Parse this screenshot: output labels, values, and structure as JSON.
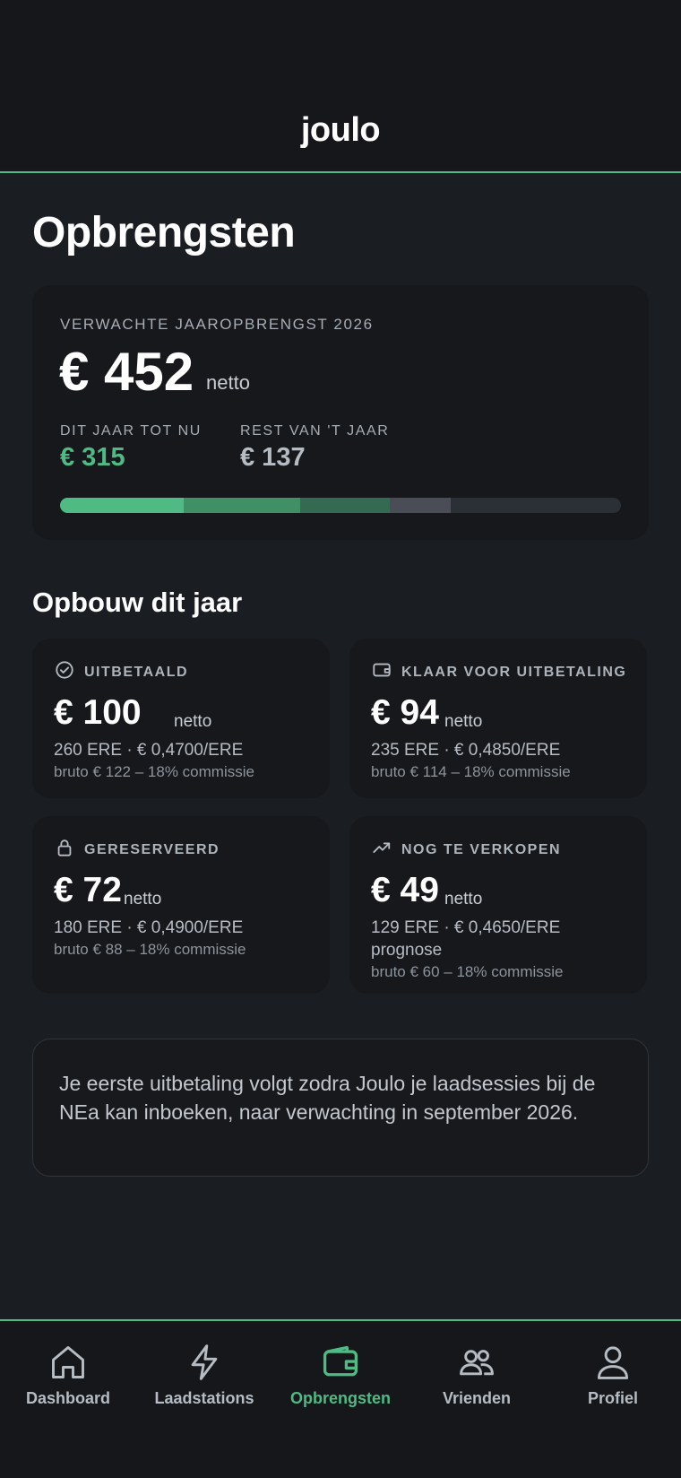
{
  "app": {
    "logo": "joulo"
  },
  "page": {
    "title": "Opbrengsten"
  },
  "hero": {
    "label": "VERWACHTE JAAROPBRENGST 2026",
    "amount": "€ 452",
    "unit": "netto",
    "so_far_label": "DIT JAAR TOT NU",
    "so_far_value": "€ 315",
    "rest_label": "REST VAN 'T JAAR",
    "rest_value": "€ 137",
    "progress_segments": [
      {
        "name": "uitbetaald",
        "value": 100,
        "color": "#4fba83"
      },
      {
        "name": "klaar voor uitbetaling",
        "value": 94,
        "color": "#3f9065"
      },
      {
        "name": "gereserveerd",
        "value": 72,
        "color": "#356a52"
      },
      {
        "name": "nog te verkopen",
        "value": 49,
        "color": "#4a4d56"
      }
    ],
    "progress_total": 452
  },
  "breakdown": {
    "title": "Opbouw dit jaar",
    "cards": [
      {
        "icon": "check-circle-icon",
        "label": "UITBETAALD",
        "amount": "€ 100",
        "unit": "netto",
        "line1": "260 ERE · € 0,4700/ERE",
        "line2": "bruto € 122 – 18% commissie"
      },
      {
        "icon": "wallet-icon",
        "label": "KLAAR VOOR UITBETALING",
        "amount": "€ 94",
        "unit": "netto",
        "line1": "235 ERE · € 0,4850/ERE",
        "line2": "bruto € 114 – 18% commissie"
      },
      {
        "icon": "lock-icon",
        "label": "GERESERVEERD",
        "amount": "€ 72",
        "unit": "netto",
        "line1": "180 ERE · € 0,4900/ERE",
        "line2": "bruto € 88 – 18% commissie"
      },
      {
        "icon": "trending-up-icon",
        "label": "NOG TE VERKOPEN",
        "amount": "€ 49",
        "unit": "netto",
        "line1": "129 ERE · € 0,4650/ERE",
        "extra": "prognose",
        "line2": "bruto € 60 – 18% commissie"
      }
    ]
  },
  "note": {
    "text": "Je eerste uitbetaling volgt zodra Joulo je laadsessies bij de NEa kan inboeken, naar verwachting in september 2026."
  },
  "tabs": [
    {
      "label": "Dashboard",
      "icon": "home-icon",
      "active": false
    },
    {
      "label": "Laadstations",
      "icon": "lightning-icon",
      "active": false
    },
    {
      "label": "Opbrengsten",
      "icon": "wallet-icon",
      "active": true
    },
    {
      "label": "Vrienden",
      "icon": "users-icon",
      "active": false
    },
    {
      "label": "Profiel",
      "icon": "user-icon",
      "active": false
    }
  ],
  "colors": {
    "accent": "#4fba83",
    "background": "#1a1d22",
    "card": "#16181c"
  }
}
